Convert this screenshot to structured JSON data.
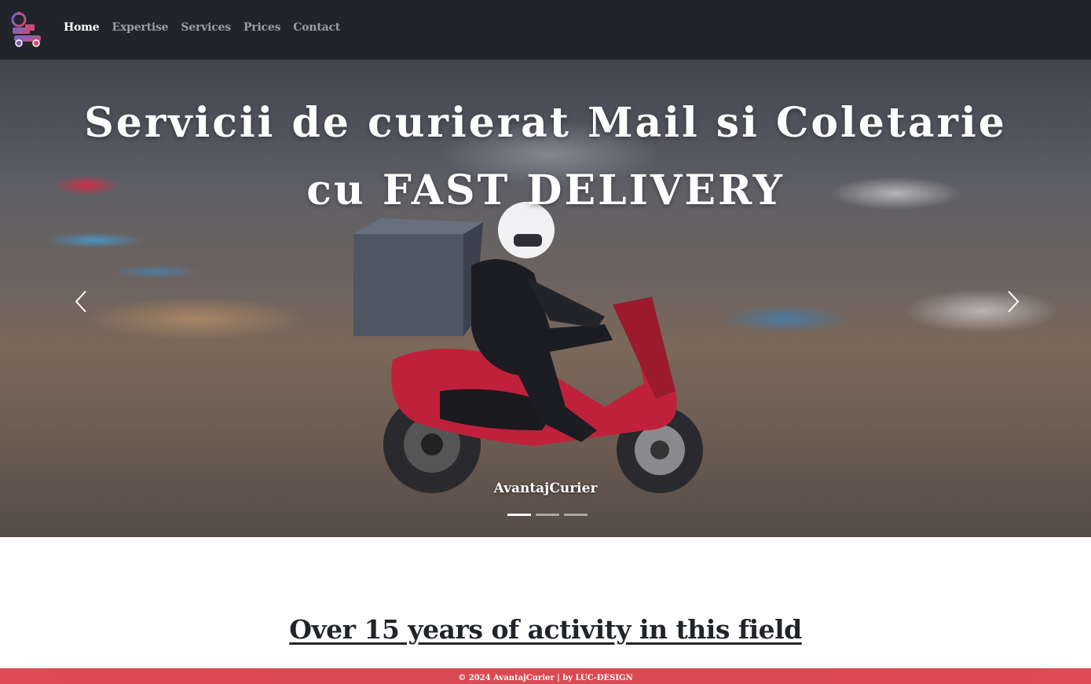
{
  "nav": {
    "logo_icon": "courier-scooter-logo-icon",
    "links": [
      {
        "label": "Home",
        "active": true
      },
      {
        "label": "Expertise",
        "active": false
      },
      {
        "label": "Services",
        "active": false
      },
      {
        "label": "Prices",
        "active": false
      },
      {
        "label": "Contact",
        "active": false
      }
    ]
  },
  "hero": {
    "title_line1": "Servicii de curierat Mail si Coletarie",
    "title_line2": "cu FAST DELIVERY",
    "caption": "AvantajCurier",
    "prev_icon": "chevron-left-icon",
    "next_icon": "chevron-right-icon",
    "slides_count": 3,
    "active_slide": 1
  },
  "section": {
    "heading": "Over 15 years of activity in this field"
  },
  "footer": {
    "text": "© 2024 AvantajCurier | by LUC-DESIGN"
  },
  "colors": {
    "navbar_bg": "#212529",
    "footer_bg": "#e04955",
    "heading_text": "#212529"
  }
}
